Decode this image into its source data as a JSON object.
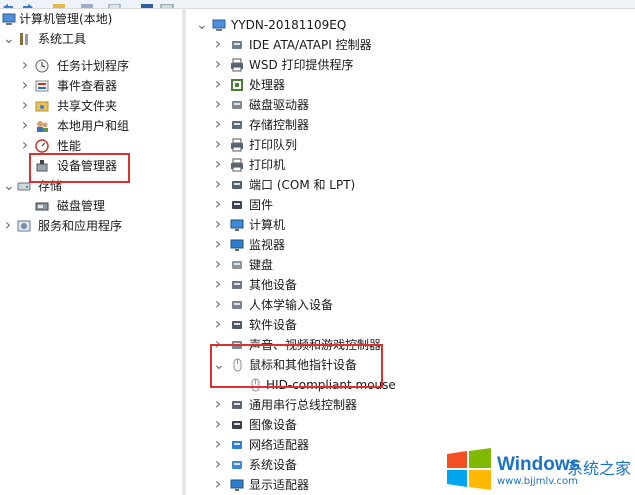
{
  "left_tree": {
    "root": "计算机管理(本地)",
    "system_tools": "系统工具",
    "task_scheduler": "任务计划程序",
    "event_viewer": "事件查看器",
    "shared_folders": "共享文件夹",
    "local_users": "本地用户和组",
    "performance": "性能",
    "device_manager": "设备管理器",
    "storage": "存储",
    "disk_management": "磁盘管理",
    "services_apps": "服务和应用程序"
  },
  "device_tree": {
    "computer_name": "YYDN-20181109EQ",
    "items": [
      {
        "label": "IDE ATA/ATAPI 控制器",
        "icon": "ide-controller-icon"
      },
      {
        "label": "WSD 打印提供程序",
        "icon": "printer-icon"
      },
      {
        "label": "处理器",
        "icon": "processor-icon"
      },
      {
        "label": "磁盘驱动器",
        "icon": "disk-drive-icon"
      },
      {
        "label": "存储控制器",
        "icon": "storage-controller-icon"
      },
      {
        "label": "打印队列",
        "icon": "printer-icon"
      },
      {
        "label": "打印机",
        "icon": "printer-icon"
      },
      {
        "label": "端口 (COM 和 LPT)",
        "icon": "port-icon"
      },
      {
        "label": "固件",
        "icon": "firmware-icon"
      },
      {
        "label": "计算机",
        "icon": "computer-icon"
      },
      {
        "label": "监视器",
        "icon": "monitor-icon"
      },
      {
        "label": "键盘",
        "icon": "keyboard-icon"
      },
      {
        "label": "其他设备",
        "icon": "unknown-device-icon"
      },
      {
        "label": "人体学输入设备",
        "icon": "hid-icon"
      },
      {
        "label": "软件设备",
        "icon": "software-device-icon"
      },
      {
        "label": "声音、视频和游戏控制器",
        "icon": "sound-icon"
      },
      {
        "label": "鼠标和其他指针设备",
        "icon": "mouse-icon"
      },
      {
        "label": "HID-compliant mouse",
        "icon": "mouse-icon"
      },
      {
        "label": "通用串行总线控制器",
        "icon": "usb-icon"
      },
      {
        "label": "图像设备",
        "icon": "camera-icon"
      },
      {
        "label": "网络适配器",
        "icon": "network-adapter-icon"
      },
      {
        "label": "系统设备",
        "icon": "system-device-icon"
      },
      {
        "label": "显示适配器",
        "icon": "display-adapter-icon"
      }
    ]
  },
  "watermark": {
    "brand": "Windows",
    "suffix": "系统之家",
    "url": "www.bjjmlv.com"
  },
  "colors": {
    "highlight_red": "#d93232",
    "accent_blue": "#1b73c4"
  }
}
